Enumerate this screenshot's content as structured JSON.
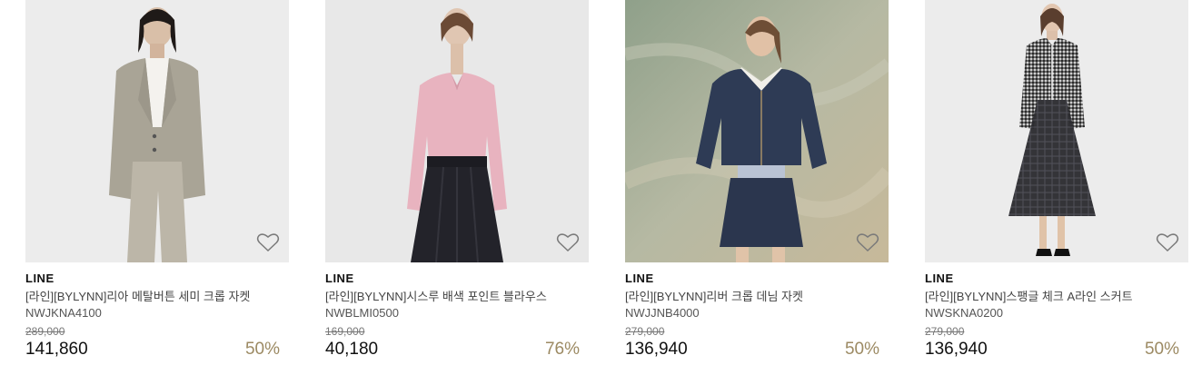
{
  "products": [
    {
      "brand": "LINE",
      "name": "[라인][BYLYNN]리아 메탈버튼 세미 크롭 자켓",
      "code": "NWJKNA4100",
      "original_price": "289,000",
      "sale_price": "141,860",
      "discount": "50%"
    },
    {
      "brand": "LINE",
      "name": "[라인][BYLYNN]시스루 배색 포인트 블라우스",
      "code": "NWBLMI0500",
      "original_price": "169,000",
      "sale_price": "40,180",
      "discount": "76%"
    },
    {
      "brand": "LINE",
      "name": "[라인][BYLYNN]리버 크롭 데님 자켓",
      "code": "NWJJNB4000",
      "original_price": "279,000",
      "sale_price": "136,940",
      "discount": "50%"
    },
    {
      "brand": "LINE",
      "name": "[라인][BYLYNN]스팽글 체크 A라인 스커트",
      "code": "NWSKNA0200",
      "original_price": "279,000",
      "sale_price": "136,940",
      "discount": "50%"
    }
  ],
  "colors": {
    "discount": "#9c8a63",
    "price": "#111111"
  },
  "icons": {
    "wishlist": "heart-outline-icon"
  }
}
